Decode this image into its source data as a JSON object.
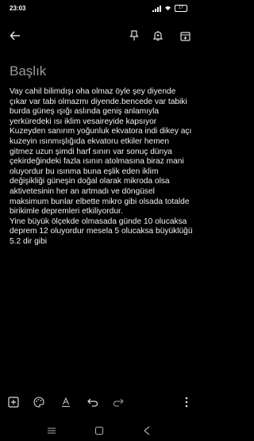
{
  "status_bar": {
    "time": "23:03",
    "battery": "17"
  },
  "toolbar": {
    "icons": [
      "back-arrow-icon",
      "pin-icon",
      "reminder-bell-icon",
      "archive-icon"
    ]
  },
  "note": {
    "title_placeholder": "Başlık",
    "body": "Vay cahil bilimdışı oha olmaz öyle şey diyende çıkar var tabi olmazmı diyende.bencede var tabiki burda güneş ışığı aslında geniş anlamıyla yerküredeki ısı iklim vesaireyide kapsıyor\nKuzeyden sanırım yoğunluk ekvatora indi dikey açı kuzeyin ısınmışlığıda ekvatoru etkiler hemen gitmez uzun şimdi harf sınırı var sonuç dünya çekirdeğindeki fazla ısının atolmasına biraz mani oluyordur bu ısınma buna eşlik eden iklim değişikliği güneşin doğal olarak mikroda olsa aktivetesinin her an artmadı ve döngüsel maksimum bunlar elbette mikro gibi olsada totalde birikimle depremleri etkiliyordur.\nYine büyük ölçekde olmasada günde 10 olucaksa deprem 12 oluyordur mesela 5 olucaksa büyüklüğü 5.2 dir gibi"
  },
  "bottom_bar": {
    "icons": [
      "add-box-icon",
      "palette-icon",
      "text-format-icon",
      "undo-icon",
      "redo-icon",
      "more-vert-icon"
    ]
  },
  "nav_bar": {
    "icons": [
      "menu-icon",
      "home-icon",
      "back-icon"
    ]
  }
}
